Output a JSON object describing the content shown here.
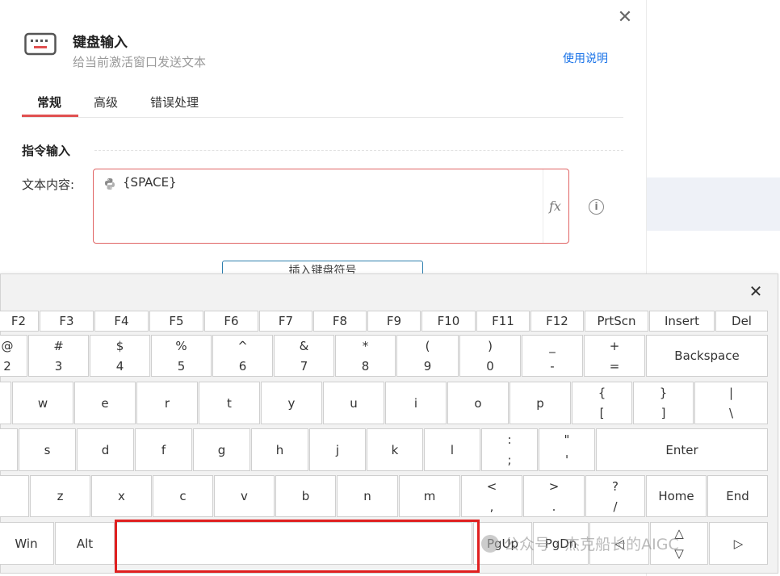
{
  "dialog": {
    "title": "键盘输入",
    "subtitle": "给当前激活窗口发送文本",
    "help_link": "使用说明",
    "close_glyph": "✕"
  },
  "tabs": [
    {
      "label": "常规",
      "active": true
    },
    {
      "label": "高级",
      "active": false
    },
    {
      "label": "错误处理",
      "active": false
    }
  ],
  "section": {
    "title": "指令输入"
  },
  "text_field": {
    "label": "文本内容:",
    "value": "{SPACE}",
    "fx_label": "fx",
    "info_glyph": "i"
  },
  "insert_button": {
    "label": "插入键盘符号"
  },
  "keyboard": {
    "close_glyph": "✕",
    "row_fn": [
      "F2",
      "F3",
      "F4",
      "F5",
      "F6",
      "F7",
      "F8",
      "F9",
      "F10",
      "F11",
      "F12",
      "PrtScn",
      "Insert",
      "Del"
    ],
    "row_num": [
      {
        "top": "@",
        "bottom": "2"
      },
      {
        "top": "#",
        "bottom": "3"
      },
      {
        "top": "$",
        "bottom": "4"
      },
      {
        "top": "%",
        "bottom": "5"
      },
      {
        "top": "^",
        "bottom": "6"
      },
      {
        "top": "&",
        "bottom": "7"
      },
      {
        "top": "*",
        "bottom": "8"
      },
      {
        "top": "(",
        "bottom": "9"
      },
      {
        "top": ")",
        "bottom": "0"
      },
      {
        "top": "_",
        "bottom": "-"
      },
      {
        "top": "+",
        "bottom": "="
      }
    ],
    "backspace": "Backspace",
    "row_q": [
      "w",
      "e",
      "r",
      "t",
      "y",
      "u",
      "i",
      "o",
      "p"
    ],
    "row_q_sym": [
      {
        "top": "{",
        "bottom": "["
      },
      {
        "top": "}",
        "bottom": "]"
      },
      {
        "top": "|",
        "bottom": "\\"
      }
    ],
    "row_a": [
      "s",
      "d",
      "f",
      "g",
      "h",
      "j",
      "k",
      "l"
    ],
    "row_a_sym": [
      {
        "top": ":",
        "bottom": ";"
      },
      {
        "top": "\"",
        "bottom": "'"
      }
    ],
    "enter": "Enter",
    "row_z": [
      "z",
      "x",
      "c",
      "v",
      "b",
      "n",
      "m"
    ],
    "row_z_sym": [
      {
        "top": "<",
        "bottom": ","
      },
      {
        "top": ">",
        "bottom": "."
      },
      {
        "top": "?",
        "bottom": "/"
      }
    ],
    "home": "Home",
    "end": "End",
    "win": "Win",
    "alt": "Alt",
    "space": "",
    "pgup": "PgUp",
    "pgdn": "PgDn",
    "arrow_left": "◁",
    "arrow_updown_top": "△",
    "arrow_updown_bottom": "▽",
    "arrow_right": "▷"
  },
  "watermark": "公众号 · 杰克船长的AIGC",
  "colors": {
    "accent_red": "#e05050",
    "link_blue": "#1a73e8",
    "highlight_red": "#e02020"
  }
}
